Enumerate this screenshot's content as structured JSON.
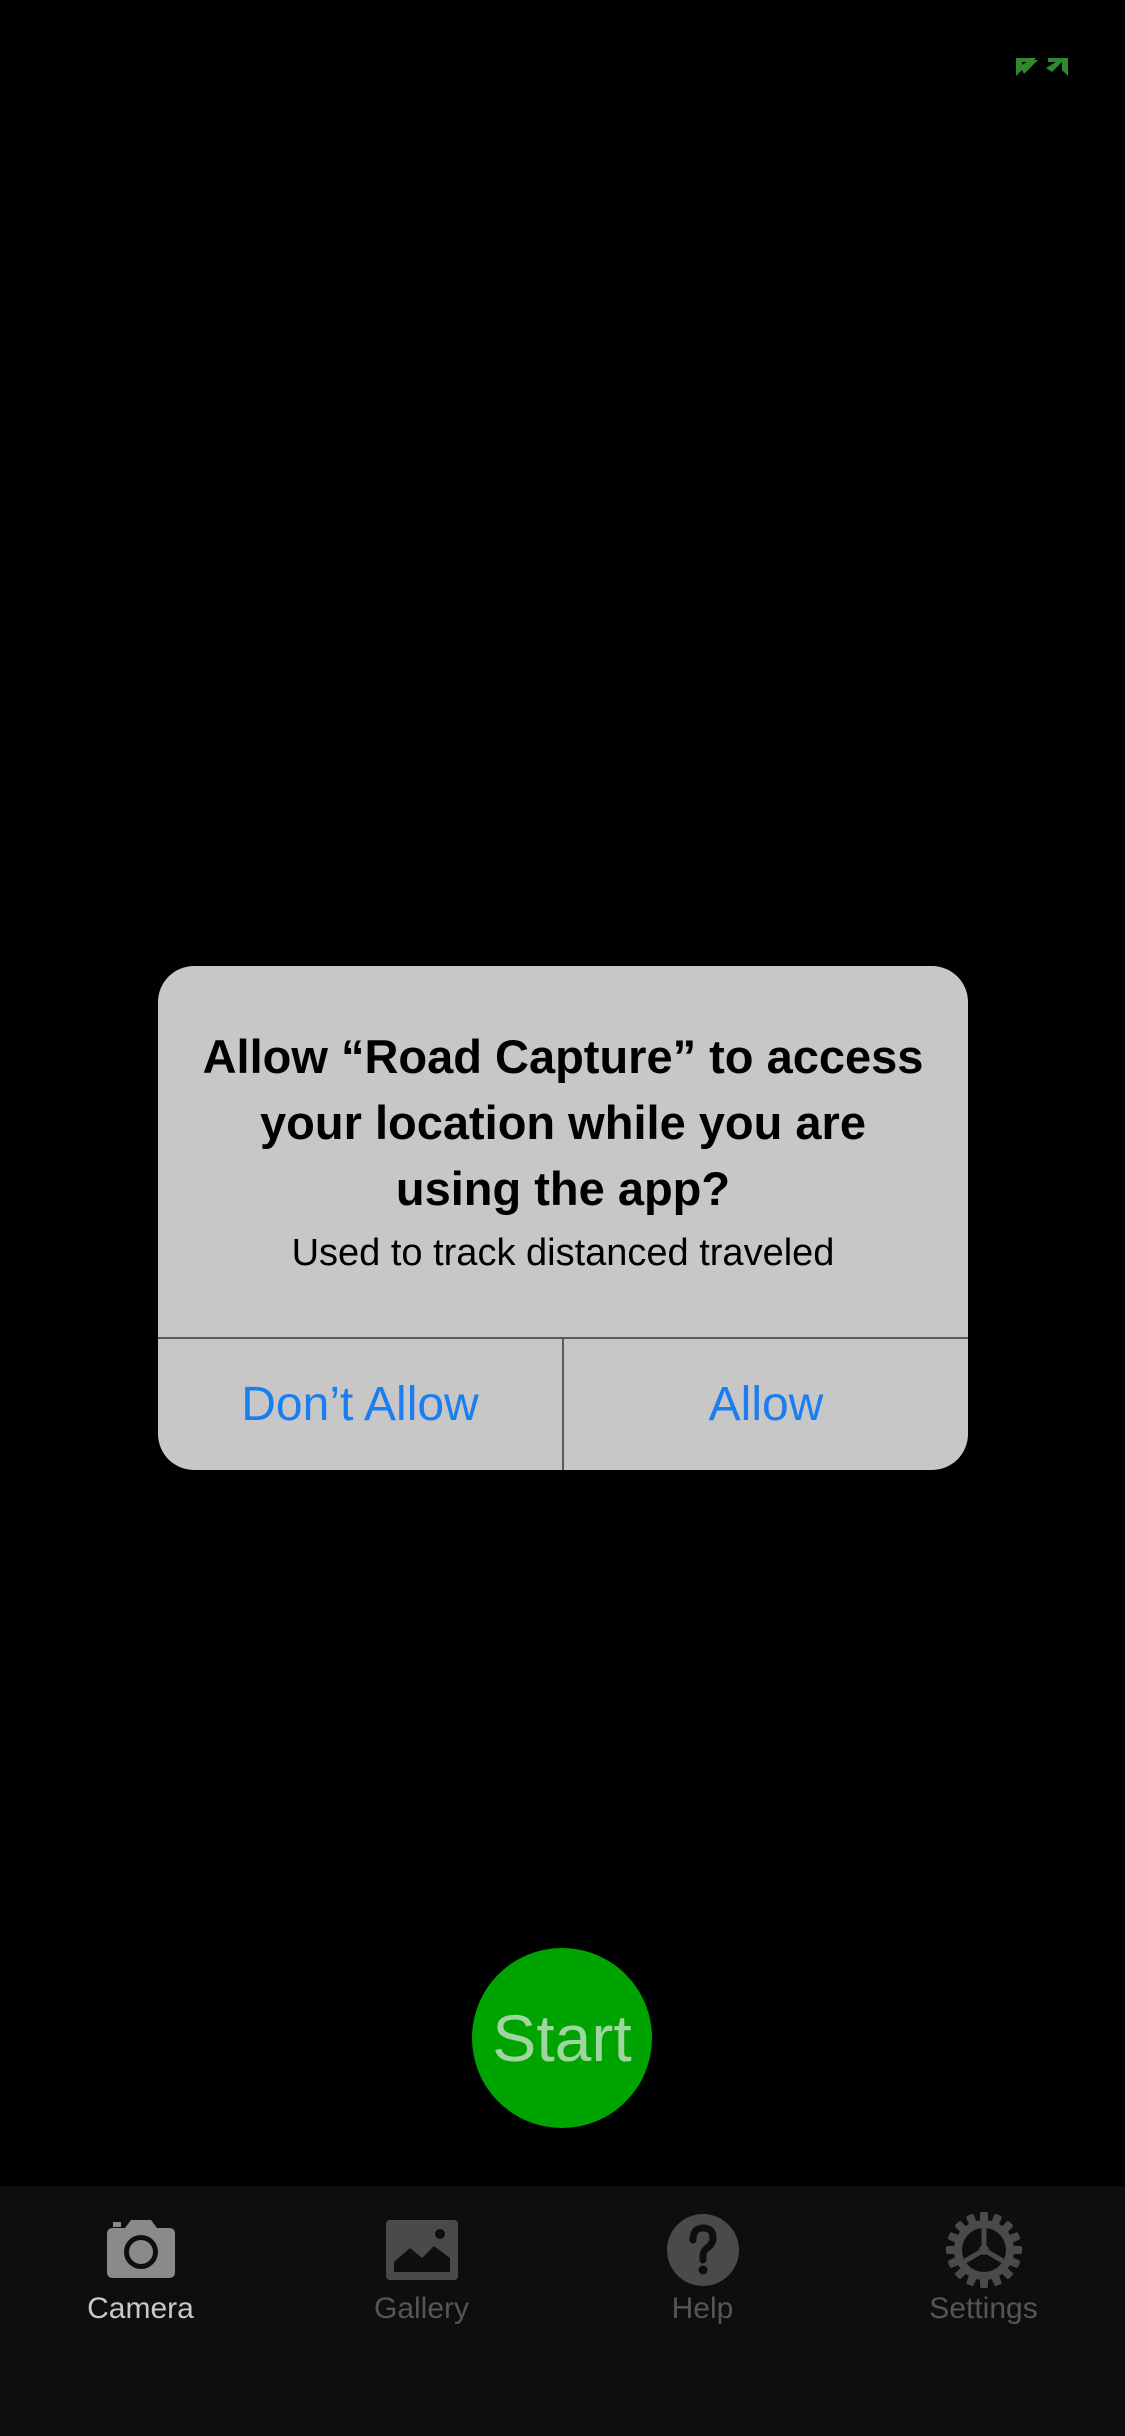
{
  "alert": {
    "title": "Allow “Road Capture” to access your location while you are using the app?",
    "message": "Used to track distanced traveled",
    "dont_allow_label": "Don’t Allow",
    "allow_label": "Allow"
  },
  "camera": {
    "start_label": "Start",
    "expand_icon": "expand-arrows-icon"
  },
  "tab_bar": {
    "tabs": [
      {
        "label": "Camera",
        "icon": "camera-icon",
        "active": true
      },
      {
        "label": "Gallery",
        "icon": "gallery-icon",
        "active": false
      },
      {
        "label": "Help",
        "icon": "help-icon",
        "active": false
      },
      {
        "label": "Settings",
        "icon": "gear-icon",
        "active": false
      }
    ]
  },
  "colors": {
    "accent_blue": "#1a7ef0",
    "start_green": "#00a400",
    "alert_bg": "#c7c7c7",
    "tab_bar_bg": "#0e0e0e"
  }
}
